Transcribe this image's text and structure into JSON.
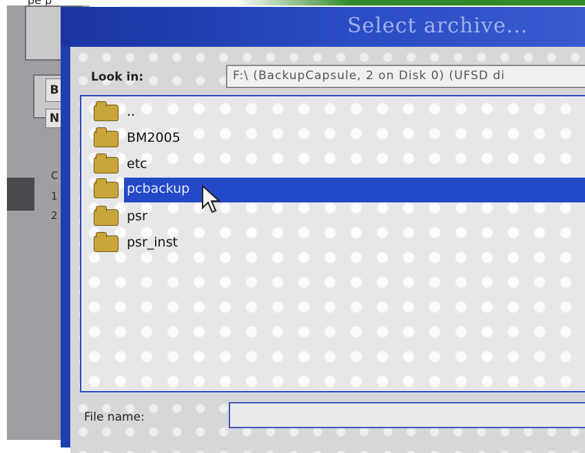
{
  "photo": {
    "top_text": "pe p"
  },
  "background_window": {
    "cells": [
      "B",
      "N"
    ],
    "rows": [
      "C",
      "1",
      "2"
    ]
  },
  "dialog": {
    "title": "Select archive...",
    "look_in": {
      "label": "Look in:",
      "value": "F:\\  (BackupCapsule, 2 on Disk 0) (UFSD di"
    },
    "items": [
      {
        "label": "..",
        "selected": false
      },
      {
        "label": "BM2005",
        "selected": false
      },
      {
        "label": "etc",
        "selected": false
      },
      {
        "label": "pcbackup",
        "selected": true
      },
      {
        "label": "psr",
        "selected": false
      },
      {
        "label": "psr_inst",
        "selected": false
      }
    ],
    "file_name": {
      "label": "File name:",
      "value": ""
    }
  },
  "colors": {
    "titlebar": "#2a4cc4",
    "selection": "#2349c8",
    "folder": "#c8a53a"
  }
}
